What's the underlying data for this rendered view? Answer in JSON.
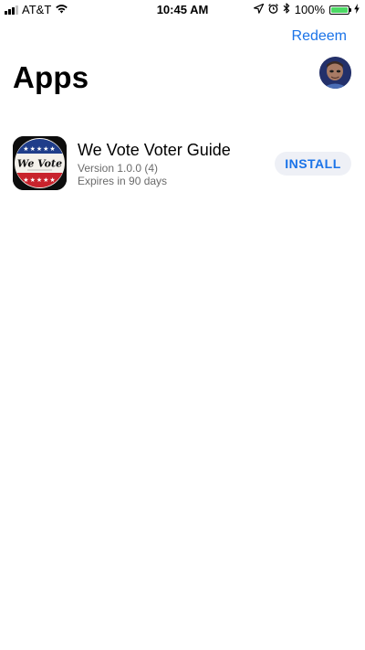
{
  "status_bar": {
    "carrier": "AT&T",
    "time": "10:45 AM",
    "battery_percent": "100%",
    "icons": [
      "signal-icon",
      "wifi-icon",
      "location-icon",
      "alarm-icon",
      "bluetooth-icon",
      "battery-icon",
      "charging-icon"
    ]
  },
  "header": {
    "redeem_label": "Redeem",
    "title": "Apps"
  },
  "apps": [
    {
      "name": "We Vote Voter Guide",
      "version": "Version 1.0.0 (4)",
      "expires": "Expires in 90 days",
      "install_label": "INSTALL",
      "icon_text": "We Vote"
    }
  ],
  "colors": {
    "accent": "#1a73e8",
    "install_bg": "#eef0f6",
    "battery_fill": "#4cd964",
    "secondary_text": "#6b6b6b"
  }
}
